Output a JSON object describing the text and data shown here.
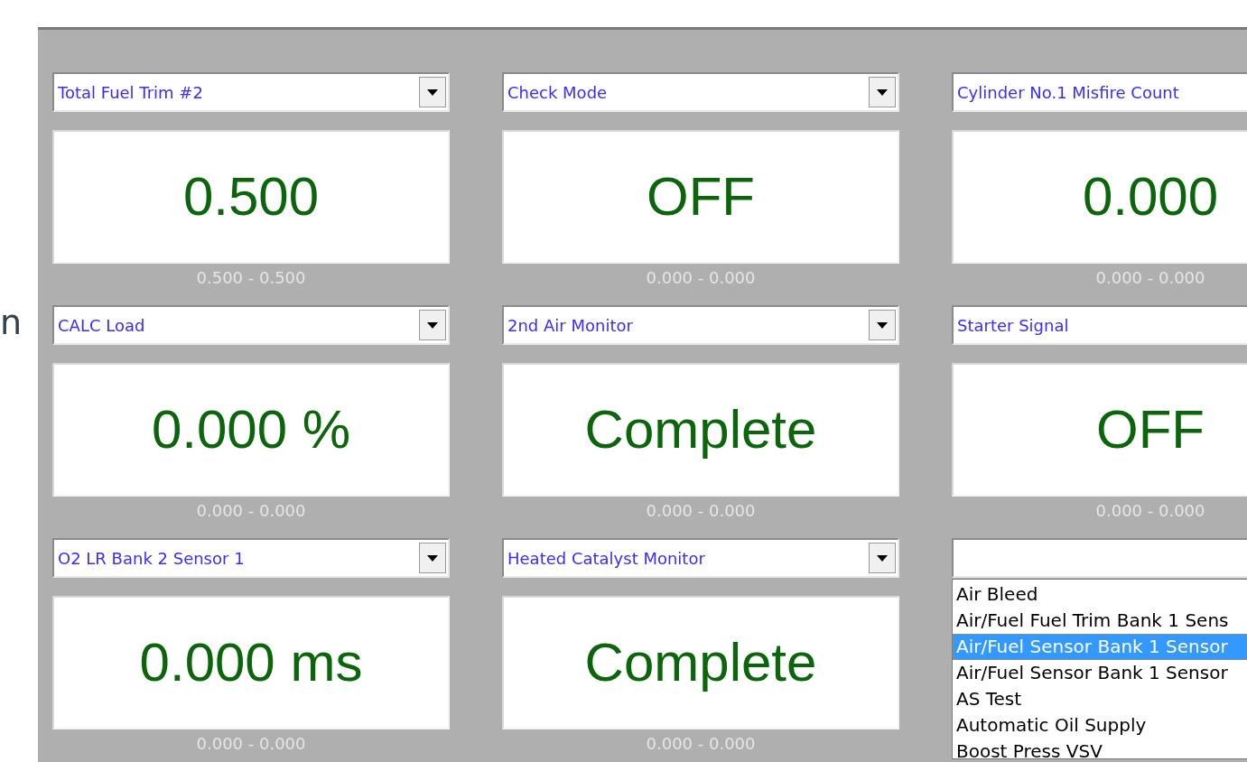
{
  "edge_text": "n",
  "gauges": [
    {
      "parameter": "Total Fuel Trim #2",
      "value": "0.500",
      "range": "0.500 - 0.500"
    },
    {
      "parameter": "Check Mode",
      "value": "OFF",
      "range": "0.000 - 0.000"
    },
    {
      "parameter": "Cylinder No.1 Misfire Count",
      "value": "0.000",
      "range": "0.000 - 0.000"
    },
    {
      "parameter": "CALC Load",
      "value": "0.000 %",
      "range": "0.000 - 0.000"
    },
    {
      "parameter": "2nd Air Monitor",
      "value": "Complete",
      "range": "0.000 - 0.000"
    },
    {
      "parameter": "Starter Signal",
      "value": "OFF",
      "range": "0.000 - 0.000"
    },
    {
      "parameter": "O2 LR Bank 2 Sensor 1",
      "value": "0.000 ms",
      "range": "0.000 - 0.000"
    },
    {
      "parameter": "Heated Catalyst Monitor",
      "value": "Complete",
      "range": "0.000 - 0.000"
    },
    {
      "dropdown_open": true,
      "options": [
        {
          "label": "Air Bleed",
          "selected": false
        },
        {
          "label": "Air/Fuel Fuel Trim Bank 1 Sens",
          "selected": false
        },
        {
          "label": "Air/Fuel Sensor Bank 1 Sensor",
          "selected": true
        },
        {
          "label": "Air/Fuel Sensor Bank 1 Sensor",
          "selected": false
        },
        {
          "label": "AS Test",
          "selected": false
        },
        {
          "label": "Automatic Oil Supply",
          "selected": false
        },
        {
          "label": "Boost Press VSV",
          "selected": false
        }
      ]
    }
  ]
}
